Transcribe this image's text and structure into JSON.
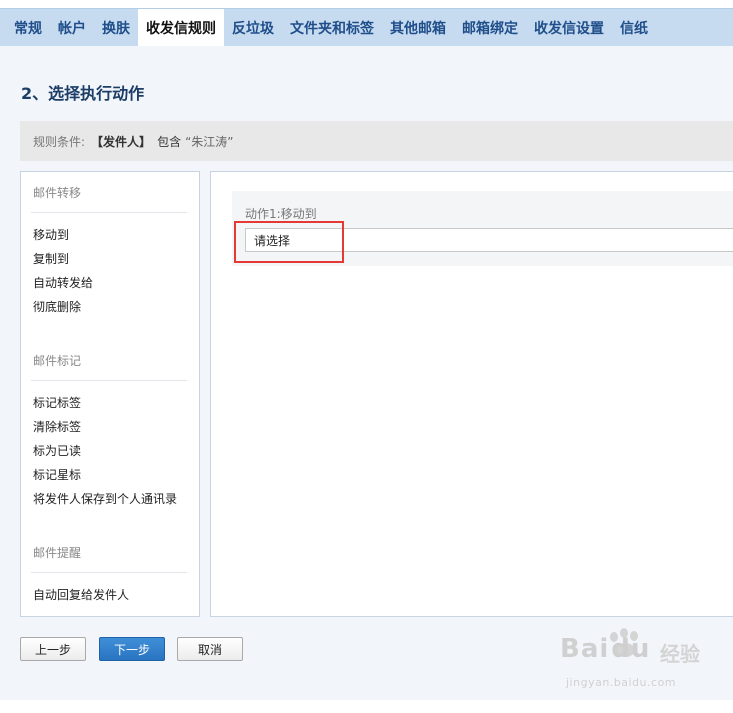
{
  "tabs": [
    {
      "label": "常规",
      "active": false
    },
    {
      "label": "帐户",
      "active": false
    },
    {
      "label": "换肤",
      "active": false
    },
    {
      "label": "收发信规则",
      "active": true
    },
    {
      "label": "反垃圾",
      "active": false
    },
    {
      "label": "文件夹和标签",
      "active": false
    },
    {
      "label": "其他邮箱",
      "active": false
    },
    {
      "label": "邮箱绑定",
      "active": false
    },
    {
      "label": "收发信设置",
      "active": false
    },
    {
      "label": "信纸",
      "active": false
    }
  ],
  "page": {
    "title": "2、选择执行动作"
  },
  "condition": {
    "label": "规则条件:",
    "field": "【发件人】",
    "operator": "包含",
    "value": "“朱江涛”"
  },
  "actions": {
    "sections": [
      {
        "title": "邮件转移",
        "items": [
          "移动到",
          "复制到",
          "自动转发给",
          "彻底删除"
        ]
      },
      {
        "title": "邮件标记",
        "items": [
          "标记标签",
          "清除标签",
          "标为已读",
          "标记星标",
          "将发件人保存到个人通讯录"
        ]
      },
      {
        "title": "邮件提醒",
        "items": [
          "自动回复给发件人"
        ]
      }
    ]
  },
  "editor": {
    "action_label": "动作1:移动到",
    "select_value": "请选择"
  },
  "buttons": {
    "prev": "上一步",
    "next": "下一步",
    "cancel": "取消"
  },
  "watermark": {
    "brand": "Bai",
    "brand_tail": "du",
    "sub": "经验",
    "url": "jingyan.baidu.com"
  },
  "colors": {
    "tab_bar": "#c6dbf0",
    "page_bg": "#f2f6fb",
    "primary": "#2a74c2",
    "highlight": "#e53935"
  }
}
